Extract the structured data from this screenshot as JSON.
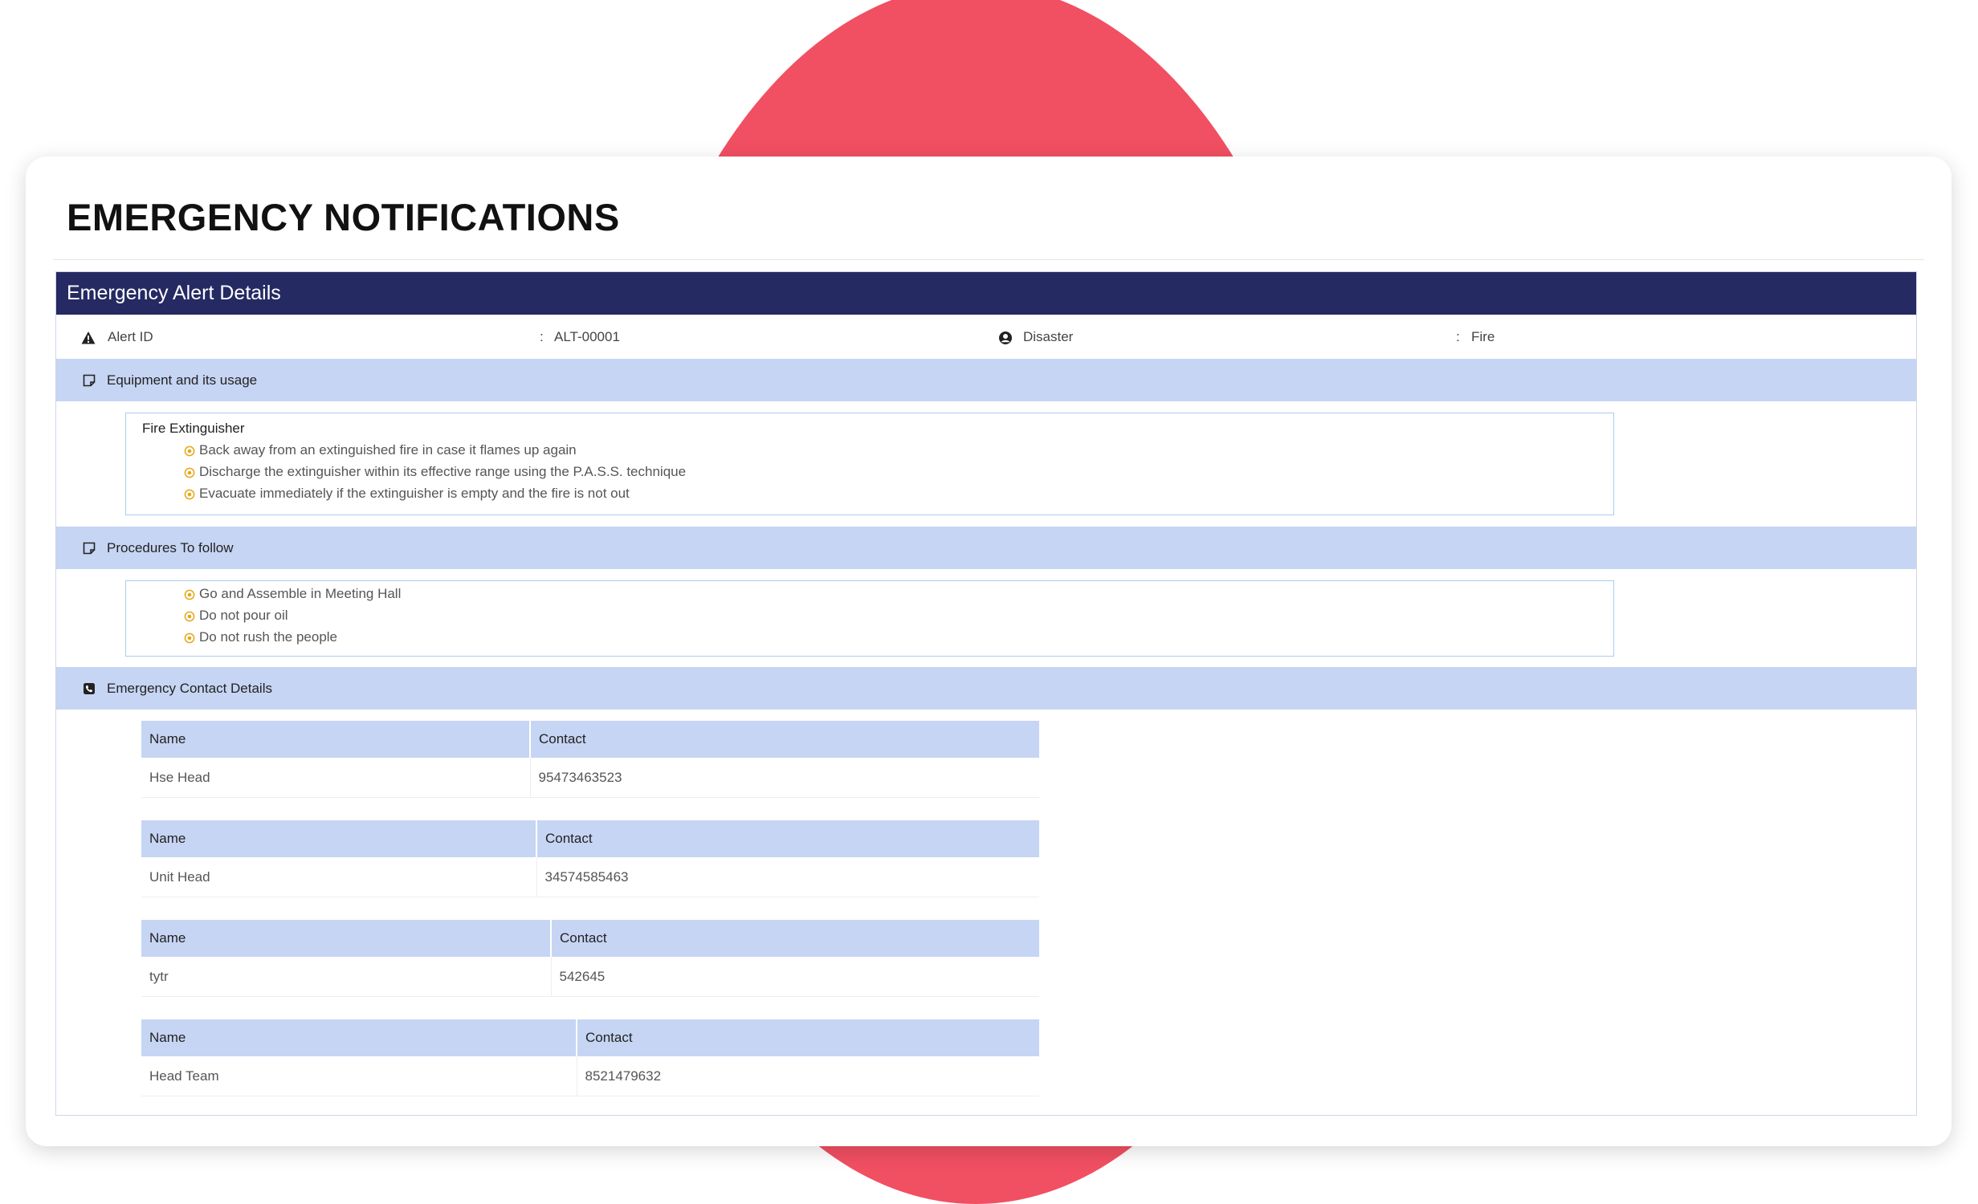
{
  "page": {
    "title": "EMERGENCY NOTIFICATIONS"
  },
  "colors": {
    "accent_circle": "#f14f62",
    "panel_header": "#252a63",
    "section_bar": "#c6d5f3",
    "bullet": "#e6a817"
  },
  "panel": {
    "header": "Emergency Alert Details"
  },
  "alert": {
    "id_label": "Alert ID",
    "id_value": "ALT-00001",
    "disaster_label": "Disaster",
    "disaster_value": "Fire",
    "separator": ":"
  },
  "sections": {
    "equipment": {
      "label": "Equipment and its usage",
      "icon": "note-icon"
    },
    "procedures": {
      "label": "Procedures To follow",
      "icon": "note-icon"
    },
    "contacts": {
      "label": "Emergency Contact Details",
      "icon": "phone-icon"
    }
  },
  "equipment": {
    "name": "Fire Extinguisher",
    "items": [
      "Back away from an extinguished fire in case it flames up again",
      "Discharge the extinguisher within its effective range using the P.A.S.S. technique",
      "Evacuate immediately if the extinguisher is empty and the fire is not out"
    ]
  },
  "procedures": {
    "items": [
      "Go and Assemble in Meeting Hall",
      "Do not pour oil",
      "Do not rush the people"
    ]
  },
  "contacts": {
    "headers": {
      "name": "Name",
      "contact": "Contact"
    },
    "rows": [
      {
        "name": "Hse Head",
        "contact": "95473463523"
      },
      {
        "name": "Unit Head",
        "contact": "34574585463"
      },
      {
        "name": "tytr",
        "contact": "542645"
      },
      {
        "name": "Head Team",
        "contact": "8521479632"
      }
    ]
  }
}
